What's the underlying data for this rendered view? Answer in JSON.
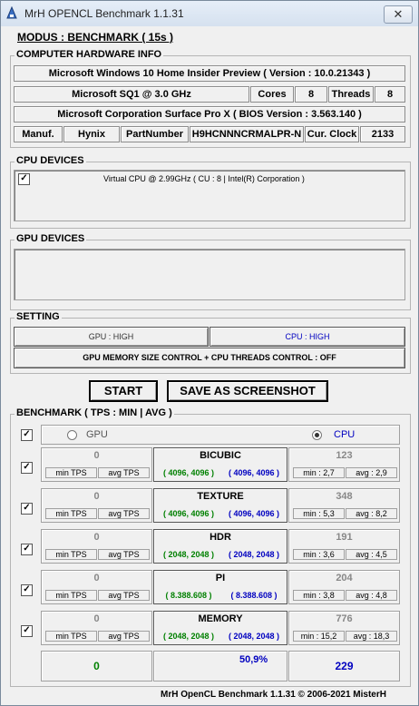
{
  "window": {
    "title": "MrH OPENCL Benchmark 1.1.31",
    "close_label": "✕"
  },
  "modus": "MODUS : BENCHMARK ( 15s )",
  "hardware": {
    "title": "COMPUTER HARDWARE INFO",
    "os": "Microsoft Windows 10 Home Insider Preview ( Version : 10.0.21343 )",
    "cpu": "Microsoft SQ1 @ 3.0 GHz",
    "cores_label": "Cores",
    "cores": "8",
    "threads_label": "Threads",
    "threads": "8",
    "board": "Microsoft Corporation Surface Pro X ( BIOS Version : 3.563.140 )",
    "manuf_label": "Manuf.",
    "manuf": "Hynix",
    "part_label": "PartNumber",
    "part": "H9HCNNNCRMALPR-N",
    "clock_label": "Cur. Clock",
    "clock": "2133"
  },
  "cpu_devices": {
    "title": "CPU DEVICES",
    "items": [
      {
        "checked": true,
        "label": "Virtual CPU @ 2.99GHz ( CU : 8 | Intel(R) Corporation )"
      }
    ]
  },
  "gpu_devices": {
    "title": "GPU DEVICES"
  },
  "setting": {
    "title": "SETTING",
    "gpu": "GPU : HIGH",
    "cpu": "CPU : HIGH",
    "memory": "GPU MEMORY SIZE CONTROL + CPU THREADS CONTROL : OFF"
  },
  "actions": {
    "start": "START",
    "screenshot": "SAVE AS SCREENSHOT"
  },
  "benchmark": {
    "title": "BENCHMARK ( TPS : MIN | AVG )",
    "gpu_label": "GPU",
    "cpu_label": "CPU",
    "min_tps": "min TPS",
    "avg_tps": "avg TPS",
    "tests": [
      {
        "name": "BICUBIC",
        "gpu": "0",
        "left_res": "( 4096, 4096 )",
        "right_res": "( 4096, 4096 )",
        "cpu": "123",
        "min": "min : 2,7",
        "avg": "avg : 2,9"
      },
      {
        "name": "TEXTURE",
        "gpu": "0",
        "left_res": "( 4096, 4096 )",
        "right_res": "( 4096, 4096 )",
        "cpu": "348",
        "min": "min : 5,3",
        "avg": "avg : 8,2"
      },
      {
        "name": "HDR",
        "gpu": "0",
        "left_res": "( 2048, 2048 )",
        "right_res": "( 2048, 2048 )",
        "cpu": "191",
        "min": "min : 3,6",
        "avg": "avg : 4,5"
      },
      {
        "name": "PI",
        "gpu": "0",
        "left_res": "( 8.388.608 )",
        "right_res": "( 8.388.608 )",
        "cpu": "204",
        "min": "min : 3,8",
        "avg": "avg : 4,8"
      },
      {
        "name": "MEMORY",
        "gpu": "0",
        "left_res": "( 2048, 2048 )",
        "right_res": "( 2048, 2048 )",
        "cpu": "776",
        "min": "min : 15,2",
        "avg": "avg : 18,3"
      }
    ],
    "total_gpu": "0",
    "total_percent": "50,9%",
    "total_cpu": "229"
  },
  "footer": "MrH OpenCL Benchmark 1.1.31  ©  2006-2021 MisterH",
  "colors": {
    "accent_green": "#008000",
    "accent_blue": "#0000c0"
  }
}
